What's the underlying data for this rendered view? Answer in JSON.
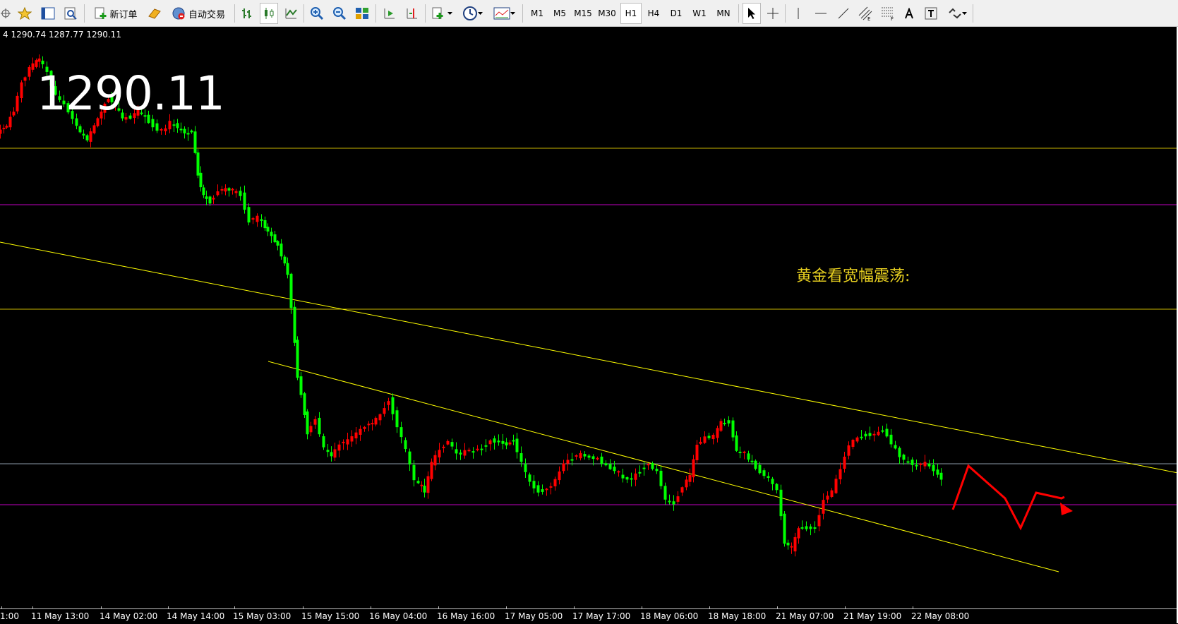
{
  "toolbar": {
    "new_order_label": "新订单",
    "auto_trade_label": "自动交易",
    "timeframes": [
      "M1",
      "M5",
      "M15",
      "M30",
      "H1",
      "H4",
      "D1",
      "W1",
      "MN"
    ],
    "selected_timeframe": "H1"
  },
  "chart": {
    "ohlc_text": "4 1290.74 1287.77 1290.11",
    "current_price": "1290.11",
    "annotation": "黄金看宽幅震荡:",
    "x_labels": [
      "1:00",
      "11 May 13:00",
      "14 May 02:00",
      "14 May 14:00",
      "15 May 03:00",
      "15 May 15:00",
      "16 May 04:00",
      "16 May 16:00",
      "17 May 05:00",
      "17 May 17:00",
      "18 May 06:00",
      "18 May 18:00",
      "21 May 07:00",
      "21 May 19:00",
      "22 May 08:00"
    ],
    "colors": {
      "up": "#ff0000",
      "down": "#00ff00",
      "trendline": "#ffff00",
      "level_yellow": "#c8b400",
      "level_magenta": "#c000c0",
      "level_gray": "#8c9aa8",
      "arrow": "#ff0000"
    }
  }
}
